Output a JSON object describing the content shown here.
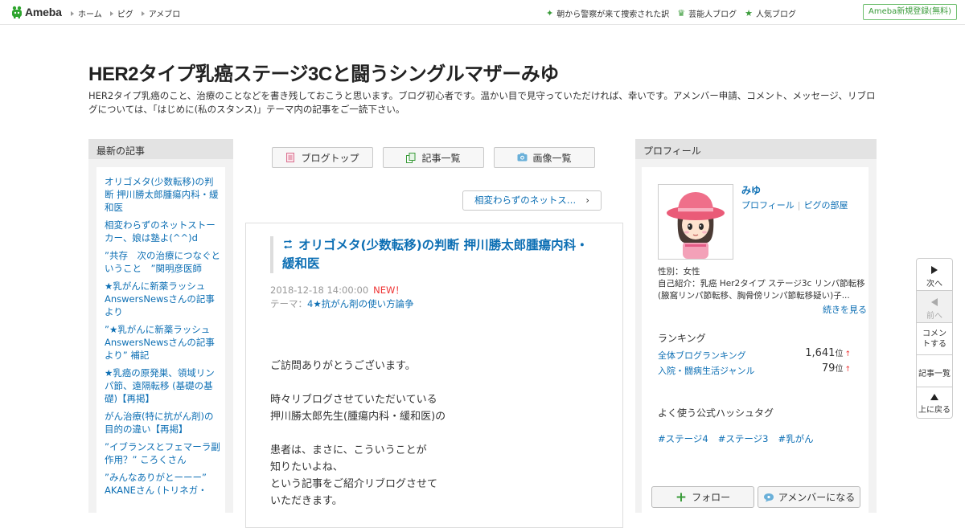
{
  "topbar": {
    "logo_text": "Ameba",
    "nav": [
      "ホーム",
      "ピグ",
      "アメブロ"
    ],
    "right_links": [
      {
        "icon": "sparkle-icon",
        "label": "朝から警察が来て捜索された訳"
      },
      {
        "icon": "crown-icon",
        "label": "芸能人ブログ"
      },
      {
        "icon": "star-icon",
        "label": "人気ブログ"
      }
    ],
    "register_label": "Ameba新規登録(無料)"
  },
  "header": {
    "title": "HER2タイプ乳癌ステージ3Cと闘うシングルマザーみゆ",
    "description": "HER2タイプ乳癌のこと、治療のことなどを書き残しておこうと思います。ブログ初心者です。温かい目で見守っていただければ、幸いです。アメンバー申請、コメント、メッセージ、リブログについては、「はじめに(私のスタンス)」テーマ内の記事をご一読下さい。"
  },
  "left_sidebar": {
    "heading": "最新の記事",
    "articles": [
      "オリゴメタ(少数転移)の判断 押川勝太郎腫瘍内科・緩和医",
      "相変わらずのネットストーカー、娘は塾よ(^^)d",
      "”共存　次の治療につなぐということ　”関明彦医師",
      "★乳がんに新薬ラッシュ AnswersNewsさんの記事より",
      "”★乳がんに新薬ラッシュ AnswersNewsさんの記事より” 補記",
      "★乳癌の原発巣、領域リンパ節、遠隔転移 (基礎の基礎)【再掲】",
      "がん治療(特に抗がん剤)の目的の違い【再掲】",
      "”イブランスとフェマーラ副作用？” ころくさん",
      "”みんなありがとーーー” AKANEさん (トリネガ・"
    ]
  },
  "center": {
    "buttons": [
      {
        "icon": "document-icon",
        "label": "ブログトップ"
      },
      {
        "icon": "copy-icon",
        "label": "記事一覧"
      },
      {
        "icon": "camera-icon",
        "label": "画像一覧"
      }
    ],
    "next_article": "相変わらずのネットス…",
    "article": {
      "title": "オリゴメタ(少数転移)の判断 押川勝太郎腫瘍内科・緩和医",
      "date": "2018-12-18 14:00:00",
      "new_label": "NEW！",
      "theme_label": "テーマ：",
      "theme": "4★抗がん剤の使い方論争",
      "paragraphs": [
        [
          "ご訪問ありがとうございます。"
        ],
        [
          "時々リブログさせていただいている",
          "押川勝太郎先生(腫瘍内科・緩和医)の"
        ],
        [
          "患者は、まさに、こういうことが",
          "知りたいよね、",
          "という記事をご紹介リブログさせて",
          "いただきます。"
        ]
      ]
    }
  },
  "profile": {
    "heading": "プロフィール",
    "name": "みゆ",
    "links": [
      "プロフィール",
      "ピグの部屋"
    ],
    "gender": "性別：女性",
    "intro": "自己紹介：乳癌 Her2タイプ ステージ3c リンパ節転移 (腋窩リンパ節転移、胸骨傍リンパ節転移疑い)子...",
    "read_more": "続きを見る",
    "ranking_title": "ランキング",
    "rankings": [
      {
        "label": "全体ブログランキング",
        "value": "1,641",
        "unit": "位",
        "arrow": "↑"
      },
      {
        "label": "入院・闘病生活ジャンル",
        "value": "79",
        "unit": "位",
        "arrow": "↑"
      }
    ],
    "hashtag_title": "よく使う公式ハッシュタグ",
    "hashtags": [
      "#ステージ4",
      "#ステージ3",
      "#乳がん"
    ],
    "follow_label": "フォロー",
    "amember_label": "アメンバーになる"
  },
  "side_nav": [
    {
      "label": "次へ",
      "icon": "arrow-right-icon"
    },
    {
      "label": "前へ",
      "icon": "arrow-left-icon"
    },
    {
      "label": "コメントする",
      "icon": ""
    },
    {
      "label": "記事一覧",
      "icon": ""
    },
    {
      "label": "上に戻る",
      "icon": "arrow-up-icon"
    }
  ]
}
